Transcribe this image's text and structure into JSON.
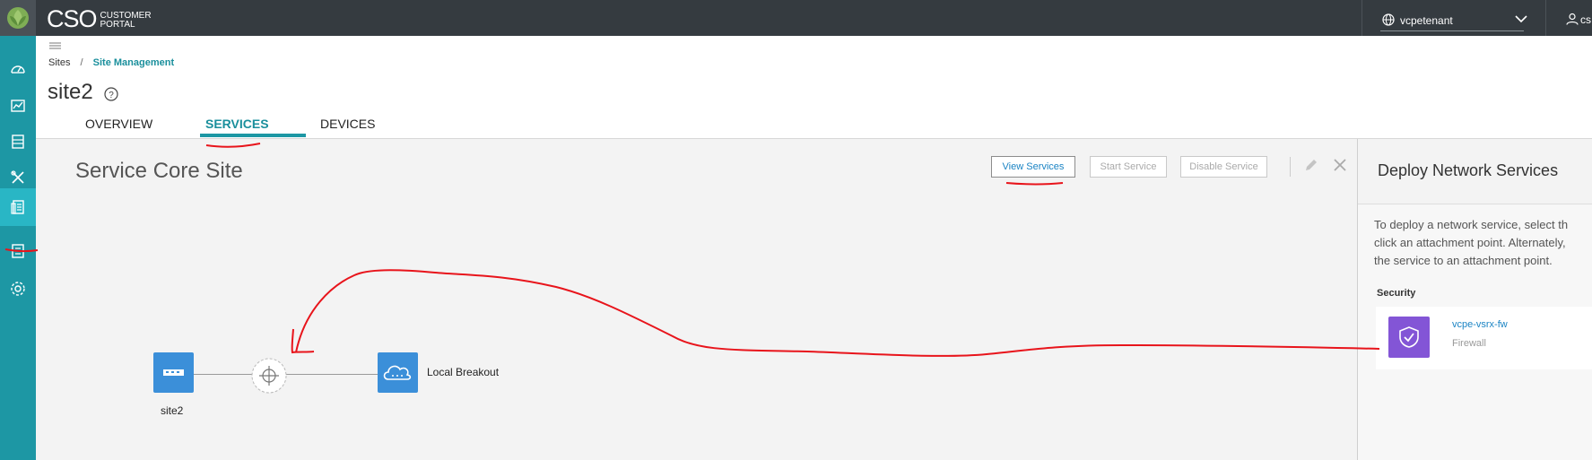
{
  "app": {
    "brand": "CSO",
    "brand_sub_1": "CUSTOMER",
    "brand_sub_2": "PORTAL",
    "tenant": "vcpetenant",
    "user": "cs"
  },
  "nav": {
    "items": [
      "dashboard-icon",
      "monitor-icon",
      "resources-icon",
      "configuration-icon",
      "administration-icon",
      "reports-icon",
      "settings-icon"
    ],
    "active_index": 4
  },
  "breadcrumb": {
    "root": "Sites",
    "separator": "/",
    "current": "Site Management"
  },
  "page": {
    "title": "site2"
  },
  "tabs": [
    {
      "label": "OVERVIEW"
    },
    {
      "label": "SERVICES",
      "active": true
    },
    {
      "label": "DEVICES"
    }
  ],
  "canvas": {
    "title": "Service Core Site",
    "buttons": {
      "view": "View Services",
      "start": "Start Service",
      "disable": "Disable Service"
    },
    "nodes": {
      "site": "site2",
      "breakout": "Local Breakout"
    }
  },
  "panel": {
    "title": "Deploy Network Services",
    "desc_line1": "To deploy a network service, select th",
    "desc_line2": "click an attachment point. Alternately,",
    "desc_line3": "the service to an attachment point.",
    "section": "Security",
    "service": {
      "name": "vcpe-vsrx-fw",
      "type": "Firewall"
    }
  },
  "colors": {
    "topbar": "#353b40",
    "nav": "#1d97a4",
    "nav_active": "#29b6c5",
    "accent": "#1a8f9c",
    "node_blue": "#3b8fd9",
    "service_purple": "#8355d6",
    "annotation": "#e8141b"
  }
}
